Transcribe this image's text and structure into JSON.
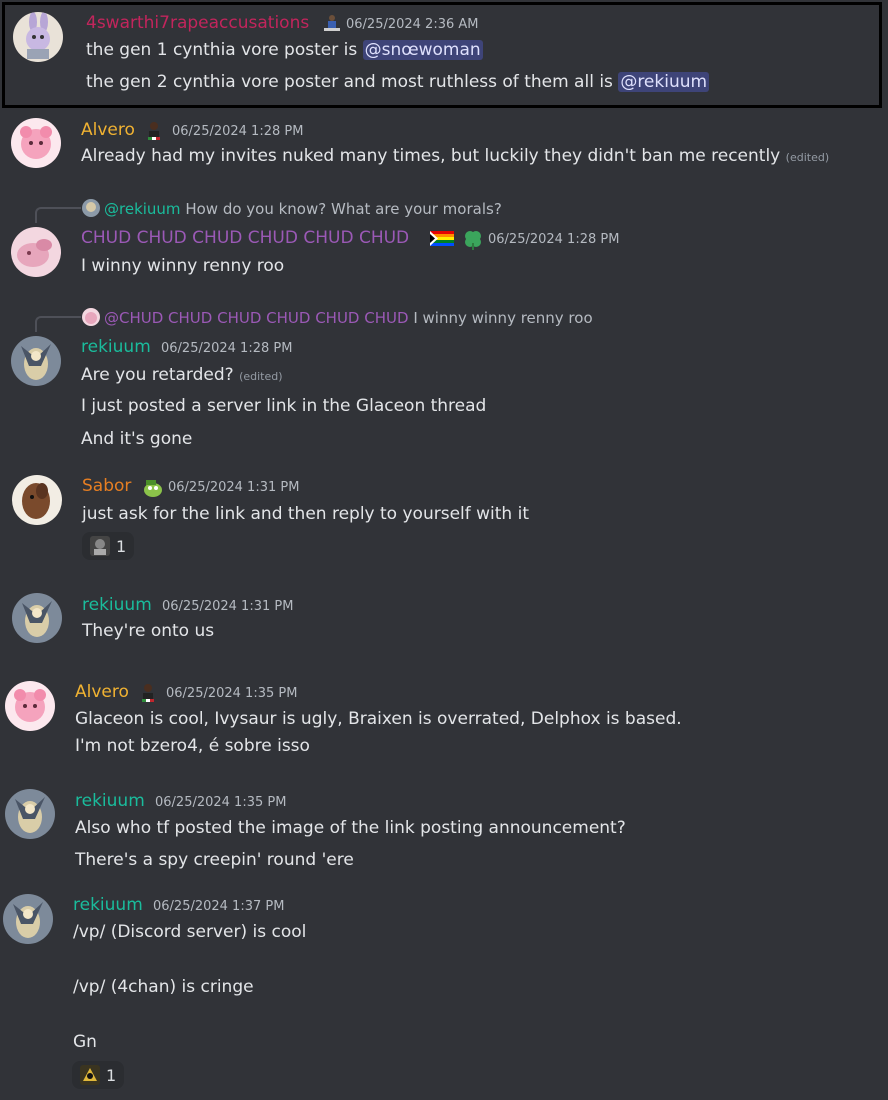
{
  "colors": {
    "background": "#313338",
    "pink_name": "#c2255c",
    "yellow_name": "#f0b232",
    "purple_name": "#9b59b6",
    "teal_name": "#1abc9c",
    "orange_name": "#e67e22",
    "mention_bg": "#3c4270",
    "timestamp": "#b5bac1"
  },
  "messages": [
    {
      "username": "4swarthi7rapeaccusations",
      "timestamp": "06/25/2024 2:36 AM",
      "line1_prefix": "the gen 1 cynthia vore poster is ",
      "line1_mention": "@snœwoman",
      "line2_prefix": "the gen 2 cynthia vore poster and most ruthless of them all is ",
      "line2_mention": "@rekiuum"
    },
    {
      "username": "Alvero",
      "timestamp": "06/25/2024 1:28 PM",
      "text": "Already had my invites nuked many times, but luckily they didn't ban me recently",
      "edited": "(edited)"
    },
    {
      "reply_mention": "@rekiuum",
      "reply_text": "How do you know?  What are your morals?",
      "username": "CHUD CHUD CHUD CHUD CHUD CHUD",
      "timestamp": "06/25/2024 1:28 PM",
      "text": "I winny winny renny roo"
    },
    {
      "reply_mention": "@CHUD CHUD CHUD CHUD CHUD CHUD",
      "reply_text": "I winny winny renny roo",
      "username": "rekiuum",
      "timestamp": "06/25/2024 1:28 PM",
      "line1": "Are you retarded?",
      "edited": "(edited)",
      "line2": "I just posted a server link in the Glaceon thread",
      "line3": "And it's gone"
    },
    {
      "username": "Sabor",
      "timestamp": "06/25/2024 1:31 PM",
      "text": "just ask for the link and then reply to yourself with it",
      "reaction_count": "1"
    },
    {
      "username": "rekiuum",
      "timestamp": "06/25/2024 1:31 PM",
      "text": "They're onto us"
    },
    {
      "username": "Alvero",
      "timestamp": "06/25/2024 1:35 PM",
      "line1": "Glaceon is cool, Ivysaur is ugly, Braixen is overrated, Delphox is based.",
      "line2": "I'm not bzero4, é sobre isso"
    },
    {
      "username": "rekiuum",
      "timestamp": "06/25/2024 1:35 PM",
      "line1": "Also who tf posted the image of the link posting announcement?",
      "line2": "There's a spy creepin' round 'ere"
    },
    {
      "username": "rekiuum",
      "timestamp": "06/25/2024 1:37 PM",
      "line1": "/vp/ (Discord server) is cool",
      "line2": "/vp/ (4chan) is cringe",
      "line3": "Gn",
      "reaction_count": "1"
    }
  ]
}
